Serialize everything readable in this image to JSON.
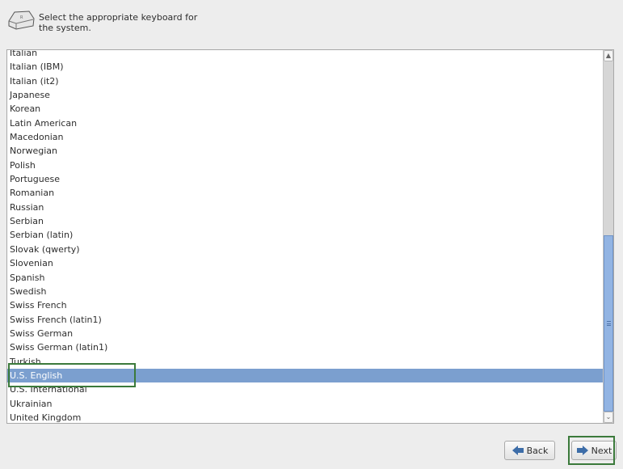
{
  "header": {
    "icon": "keyboard-key-icon",
    "text_line1": "Select the appropriate keyboard for",
    "text_line2": "the system."
  },
  "keyboard_list": {
    "items": [
      "Italian",
      "Italian (IBM)",
      "Italian (it2)",
      "Japanese",
      "Korean",
      "Latin American",
      "Macedonian",
      "Norwegian",
      "Polish",
      "Portuguese",
      "Romanian",
      "Russian",
      "Serbian",
      "Serbian (latin)",
      "Slovak (qwerty)",
      "Slovenian",
      "Spanish",
      "Swedish",
      "Swiss French",
      "Swiss French (latin1)",
      "Swiss German",
      "Swiss German (latin1)",
      "Turkish",
      "U.S. English",
      "U.S. International",
      "Ukrainian",
      "United Kingdom"
    ],
    "selected": "U.S. English",
    "scroll_position_fraction": 1.0
  },
  "buttons": {
    "back": {
      "label": "Back",
      "icon": "arrow-left-icon"
    },
    "next": {
      "label": "Next",
      "icon": "arrow-right-icon"
    }
  },
  "colors": {
    "selection": "#7b9fcf",
    "scroll_thumb": "#92b4e3",
    "highlight_annotation": "#3b7a3b",
    "arrow_icon": "#3d6da8"
  }
}
